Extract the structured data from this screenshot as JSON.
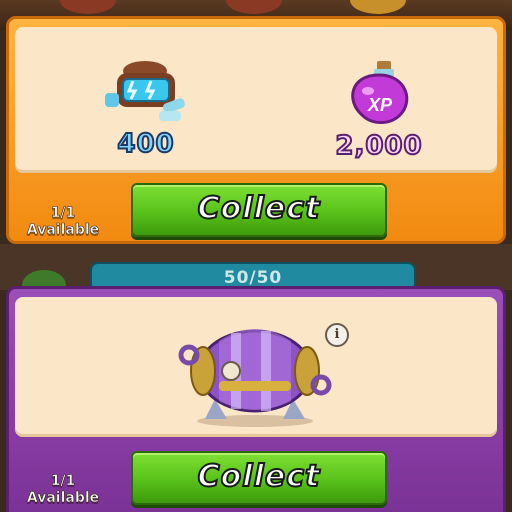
{
  "background": {
    "progress_text": "50/50"
  },
  "offer_1": {
    "rewards": [
      {
        "icon": "energy-capsule-icon",
        "amount": "400"
      },
      {
        "icon": "xp-potion-icon",
        "amount": "2,000",
        "badge": "XP"
      }
    ],
    "availability_count": "1/1",
    "availability_label": "Available",
    "collect_label": "Collect",
    "accent": "#f28a10"
  },
  "offer_2": {
    "item_icon": "purple-cannon-chest-icon",
    "info_label": "i",
    "availability_count": "1/1",
    "availability_label": "Available",
    "collect_label": "Collect",
    "accent": "#7b3296"
  }
}
